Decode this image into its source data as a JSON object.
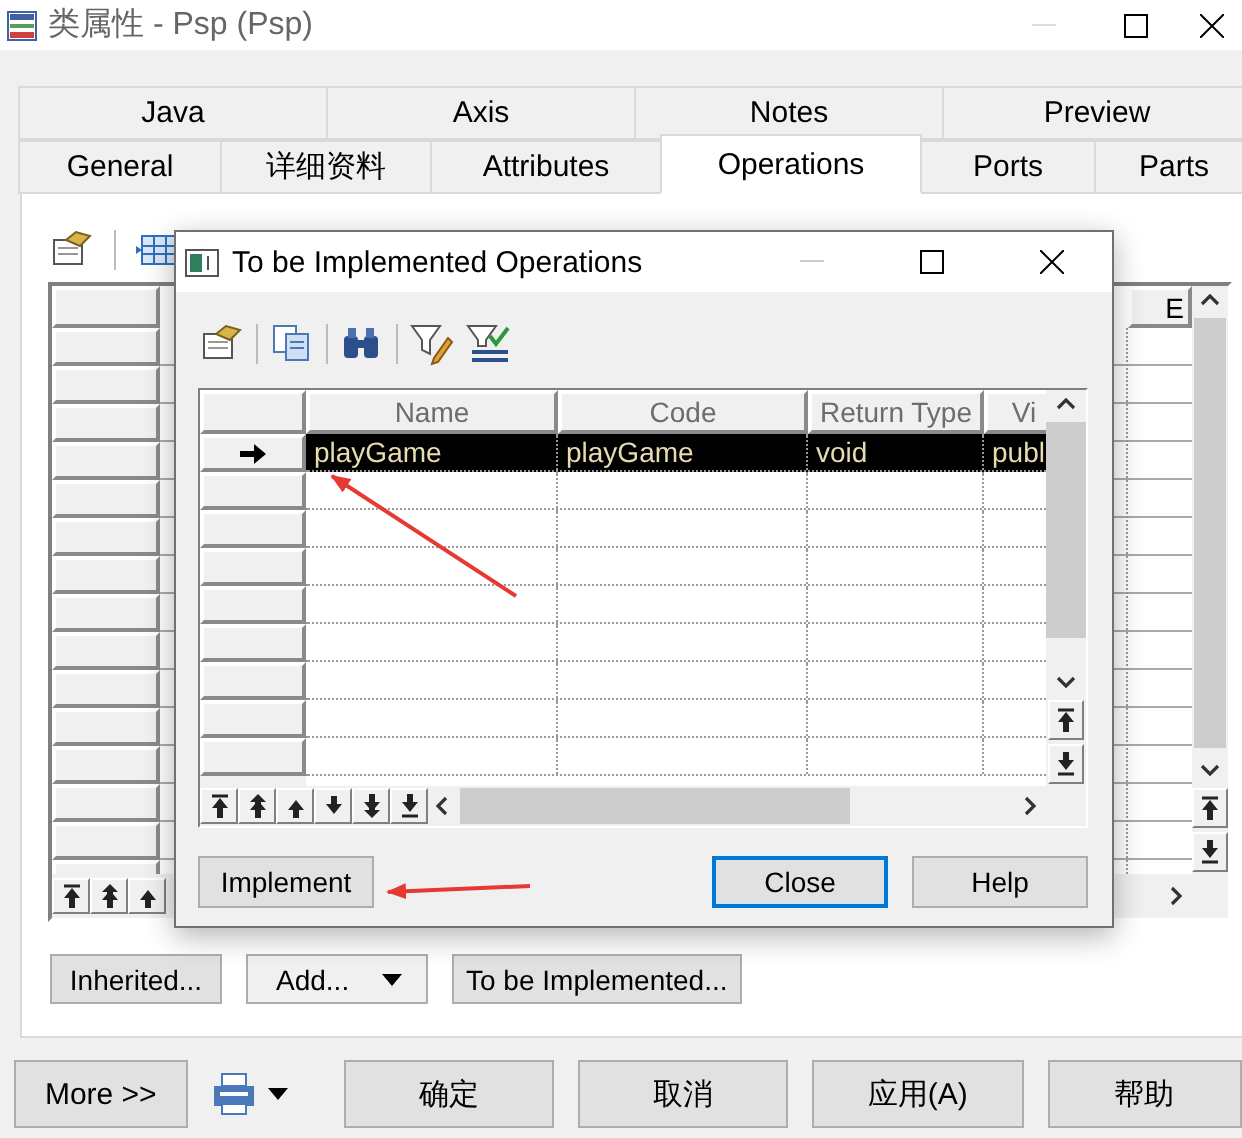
{
  "window": {
    "title": "类属性 - Psp (Psp)"
  },
  "tabs_row_1": [
    {
      "label": "Java",
      "selected": false
    },
    {
      "label": "Axis",
      "selected": false
    },
    {
      "label": "Notes",
      "selected": false
    },
    {
      "label": "Preview",
      "selected": false
    }
  ],
  "tabs_row_2": [
    {
      "label": "General",
      "selected": false
    },
    {
      "label": "详细资料",
      "selected": false
    },
    {
      "label": "Attributes",
      "selected": false
    },
    {
      "label": "Operations",
      "selected": true
    },
    {
      "label": "Ports",
      "selected": false
    },
    {
      "label": "Parts",
      "selected": false
    }
  ],
  "operations_grid": {
    "columns": [
      "E"
    ]
  },
  "panel_buttons": [
    {
      "label": "Inherited...",
      "kind": "button"
    },
    {
      "label": "Add...",
      "kind": "dropdown"
    },
    {
      "label": "To be Implemented...",
      "kind": "button"
    }
  ],
  "footer": {
    "more_button": "More >>",
    "buttons": [
      "确定",
      "取消",
      "应用(A)",
      "帮助"
    ]
  },
  "dialog": {
    "title": "To be Implemented Operations",
    "columns": [
      "Name",
      "Code",
      "Return Type",
      "Vi"
    ],
    "rows": [
      {
        "cells": [
          "playGame",
          "playGame",
          "void",
          "publ"
        ],
        "selected": true
      }
    ],
    "buttons": [
      {
        "label": "Implement",
        "default": false
      },
      {
        "label": "Close",
        "default": true
      },
      {
        "label": "Help",
        "default": false
      }
    ]
  }
}
